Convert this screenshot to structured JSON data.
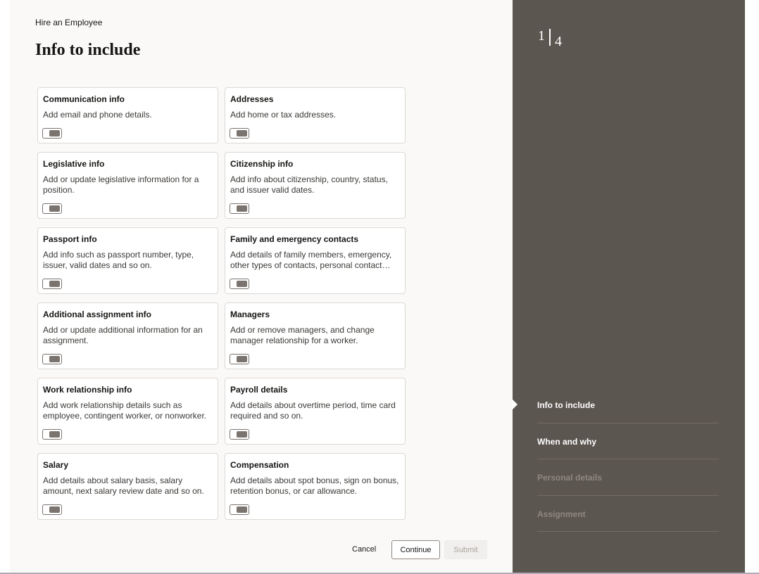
{
  "header": {
    "subtitle": "Hire an Employee",
    "title": "Info to include"
  },
  "cards": [
    {
      "title": "Communication info",
      "desc": "Add email and phone details.",
      "enabled": false
    },
    {
      "title": "Addresses",
      "desc": "Add home or tax addresses.",
      "enabled": false
    },
    {
      "title": "Legislative info",
      "desc": "Add or update legislative information for a position.",
      "enabled": false
    },
    {
      "title": "Citizenship info",
      "desc": "Add info about citizenship, country, status, and issuer valid dates.",
      "enabled": false
    },
    {
      "title": "Passport info",
      "desc": "Add info such as passport number, type, issuer, valid dates and so on.",
      "enabled": false
    },
    {
      "title": "Family and emergency contacts",
      "desc": "Add details of family members, emergency, other types of contacts, personal contact…",
      "enabled": false
    },
    {
      "title": "Additional assignment info",
      "desc": "Add or update additional information for an assignment.",
      "enabled": false
    },
    {
      "title": "Managers",
      "desc": "Add or remove managers, and change manager relationship for a worker.",
      "enabled": false
    },
    {
      "title": "Work relationship info",
      "desc": "Add work relationship details such as employee, contingent worker, or nonworker.",
      "enabled": false
    },
    {
      "title": "Payroll details",
      "desc": "Add details about overtime period, time card required and so on.",
      "enabled": false
    },
    {
      "title": "Salary",
      "desc": "Add details about salary basis, salary amount, next salary review date and so on.",
      "enabled": false
    },
    {
      "title": "Compensation",
      "desc": "Add details about spot bonus, sign on bonus, retention bonus, or car allowance.",
      "enabled": false
    }
  ],
  "footer": {
    "cancel_label": "Cancel",
    "continue_label": "Continue",
    "submit_label": "Submit"
  },
  "train": {
    "current": "1",
    "total": "4",
    "steps": [
      {
        "label": "Info to include",
        "state": "active"
      },
      {
        "label": "When and why",
        "state": "visited"
      },
      {
        "label": "Personal details",
        "state": "disabled"
      },
      {
        "label": "Assignment",
        "state": "disabled"
      }
    ]
  },
  "colors": {
    "side_panel": "#5c5650",
    "main_bg": "#fbf9f8",
    "card_border": "#dcd9d4"
  }
}
